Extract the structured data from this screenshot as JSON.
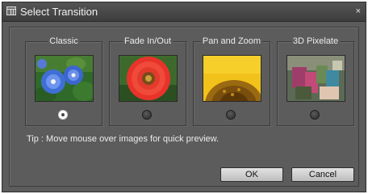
{
  "window": {
    "title": "Select Transition",
    "close_label": "×"
  },
  "transitions": [
    {
      "label": "Classic",
      "selected": true,
      "image": "blue-morning-glory-flowers"
    },
    {
      "label": "Fade In/Out",
      "selected": false,
      "image": "red-gerbera-daisy"
    },
    {
      "label": "Pan and Zoom",
      "selected": false,
      "image": "sunflower-closeup"
    },
    {
      "label": "3D Pixelate",
      "selected": false,
      "image": "pixelated-flower"
    }
  ],
  "tip": "Tip : Move mouse over images for quick preview.",
  "buttons": {
    "ok": "OK",
    "cancel": "Cancel"
  },
  "colors": {
    "dialog_bg": "#5c5c5c",
    "titlebar_bg": "#464646",
    "text": "#ececec"
  }
}
